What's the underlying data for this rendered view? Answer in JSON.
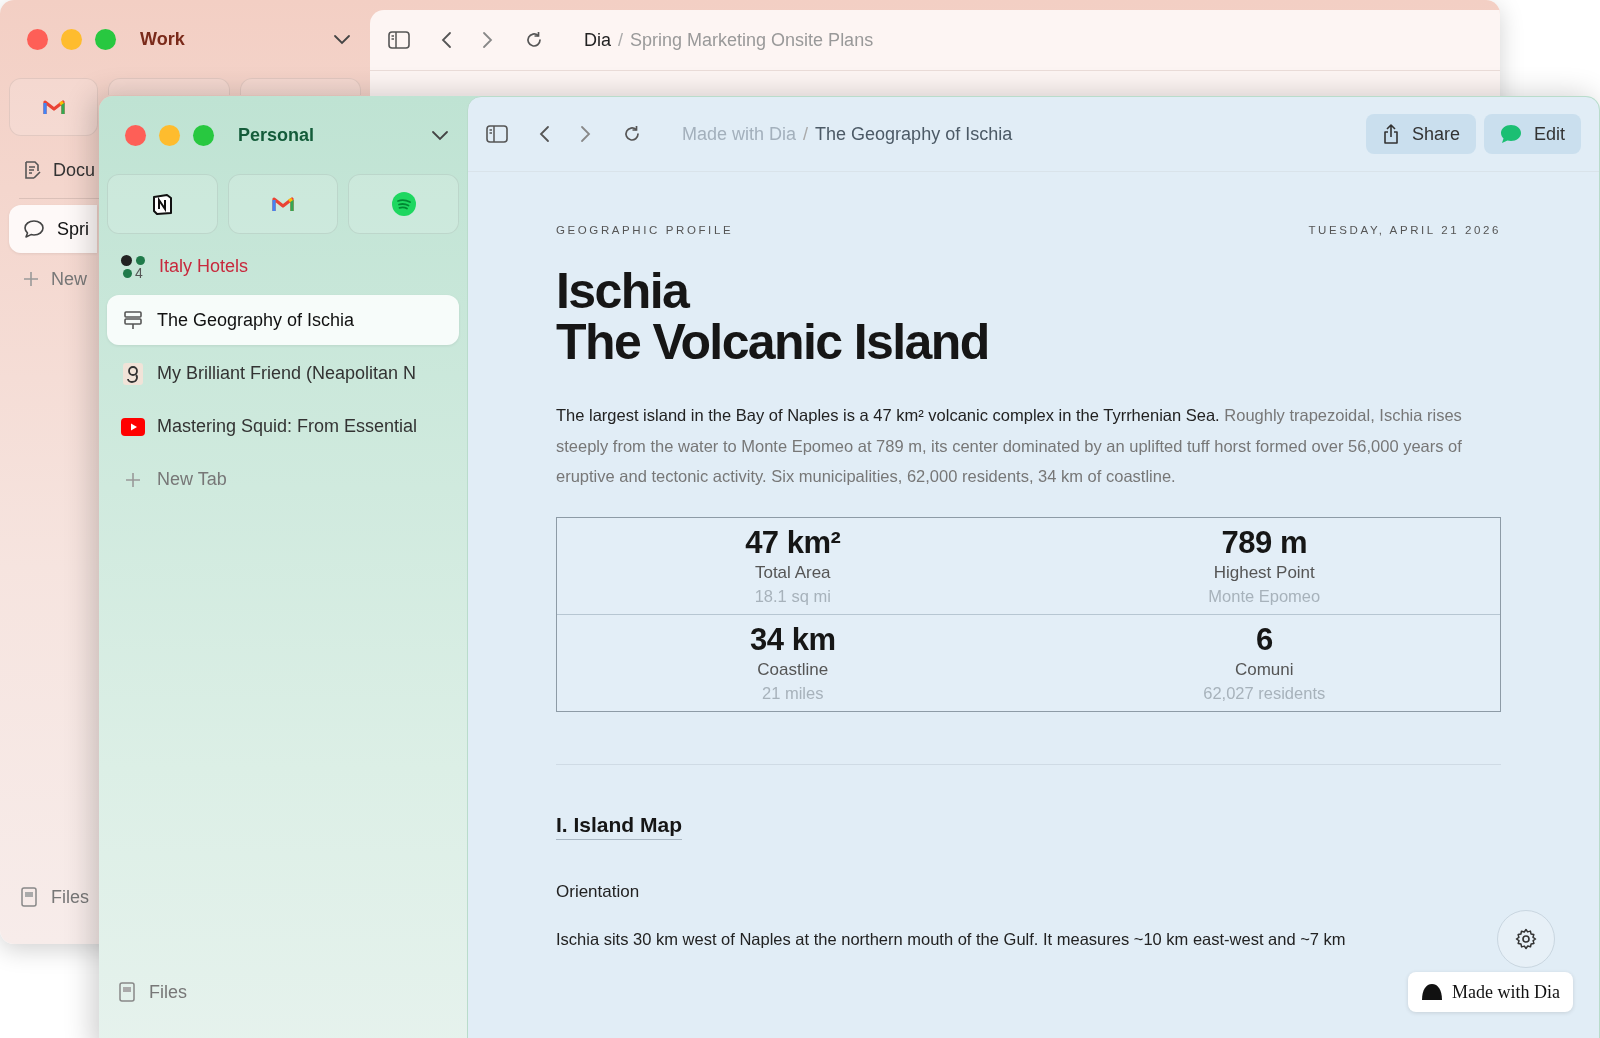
{
  "back_window": {
    "profile": "Work",
    "pinned": [
      {
        "kind": "mail"
      },
      {
        "kind": "blank"
      },
      {
        "kind": "blank"
      }
    ],
    "items": [
      {
        "kind": "doc-edit",
        "label": "Docu",
        "selected": false
      },
      {
        "kind": "chat",
        "label": "Spri",
        "selected": true
      }
    ],
    "new_tab": "New",
    "files": "Files",
    "breadcrumb": {
      "site": "Dia",
      "separator": "/",
      "page": "Spring Marketing Onsite Plans"
    }
  },
  "front_window": {
    "profile": "Personal",
    "pinned": [
      {
        "kind": "cube"
      },
      {
        "kind": "mail"
      },
      {
        "kind": "waves"
      }
    ],
    "items": [
      {
        "kind": "group",
        "label": "Italy Hotels",
        "count": "4",
        "color": "#c8283c",
        "selected": false
      },
      {
        "kind": "doc",
        "label": "The Geography of Ischia",
        "selected": true
      },
      {
        "kind": "book",
        "label": "My Brilliant Friend (Neapolitan N",
        "selected": false
      },
      {
        "kind": "video",
        "label": "Mastering Squid: From Essential",
        "selected": false
      }
    ],
    "new_tab": "New Tab",
    "files": "Files",
    "breadcrumb": {
      "site": "Made with Dia",
      "separator": "/",
      "page": "The Geography of Ischia"
    },
    "buttons": [
      {
        "kind": "share",
        "label": "Share"
      },
      {
        "kind": "edit",
        "label": "Edit"
      }
    ],
    "page": {
      "eyebrow": "GEOGRAPHIC PROFILE",
      "date": "TUESDAY, APRIL 21 2026",
      "title": [
        "Ischia",
        "The Volcanic Island"
      ],
      "intro": {
        "lead": "The largest island in the Bay of Naples is a 47 km² volcanic complex in the Tyrrhenian Sea.",
        "rest": "Roughly trapezoidal, Ischia rises steeply from the water to Monte Epomeo at 789 m, its center dominated by an uplifted tuff horst formed over 56,000 years of eruptive and tectonic activity. Six municipalities, 62,000 residents, 34 km of coastline."
      },
      "stats": [
        {
          "value": "47 km²",
          "label": "Total Area",
          "note": "18.1 sq mi"
        },
        {
          "value": "789 m",
          "label": "Highest Point",
          "note": "Monte Epomeo"
        },
        {
          "value": "34 km",
          "label": "Coastline",
          "note": "21 miles"
        },
        {
          "value": "6",
          "label": "Comuni",
          "note": "62,027 residents"
        }
      ],
      "section": "I. Island Map",
      "subheading": "Orientation",
      "body": "Ischia sits 30 km west of Naples at the northern mouth of the Gulf. It measures ~10 km east-west and ~7 km"
    },
    "badge": "Made with Dia"
  }
}
